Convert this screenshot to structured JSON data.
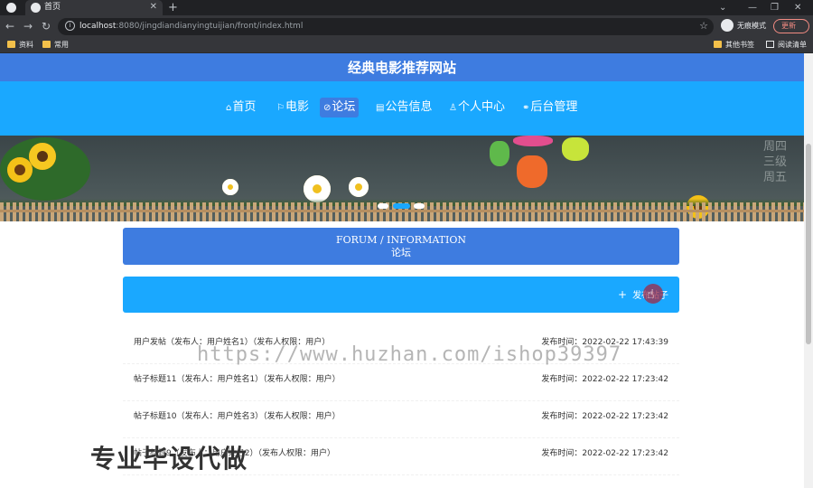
{
  "browser": {
    "tab_title": "首页",
    "tab_close": "✕",
    "new_tab": "+",
    "url_host": "localhost",
    "url_rest": ":8080/jingdiandianyingtuijian/front/index.html",
    "profile_label": "无痕模式",
    "update_label": "更新",
    "bookmarks": [
      "资料",
      "常用"
    ],
    "other_bookmarks": "其他书签",
    "reading_list": "阅读清单",
    "minimize": "—",
    "restore": "❐",
    "close": "✕",
    "back": "←",
    "forward": "→",
    "reload": "↻",
    "star": "☆",
    "tab_menu": "⌄",
    "info": "i"
  },
  "site": {
    "title": "经典电影推荐网站"
  },
  "nav": {
    "items": [
      {
        "icon": "⌂",
        "label": "首页"
      },
      {
        "icon": "⚐",
        "label": "电影"
      },
      {
        "icon": "⊘",
        "label": "论坛",
        "active": true
      },
      {
        "icon": "▤",
        "label": "公告信息"
      },
      {
        "icon": "♙",
        "label": "个人中心"
      },
      {
        "icon": "⚭",
        "label": "后台管理"
      }
    ]
  },
  "banner": {
    "scribble": "周四\n三级\n周五",
    "slides": 3,
    "active_slide": 2
  },
  "forum": {
    "title_en": "FORUM / INFORMATION",
    "title_zh": "论坛",
    "post_button": "发布帖子",
    "post_icon": "+"
  },
  "posts": [
    {
      "title": "用户发帖（发布人：用户姓名1）（发布人权限：用户）",
      "time": "发布时间：2022-02-22 17:43:39"
    },
    {
      "title": "帖子标题11（发布人：用户姓名1）（发布人权限：用户）",
      "time": "发布时间：2022-02-22 17:23:42"
    },
    {
      "title": "帖子标题10（发布人：用户姓名3）（发布人权限：用户）",
      "time": "发布时间：2022-02-22 17:23:42"
    },
    {
      "title": "帖子标题9（发布人：用户姓名2）（发布人权限：用户）",
      "time": "发布时间：2022-02-22 17:23:42"
    }
  ],
  "watermark": "https://www.huzhan.com/ishop39397",
  "overlay": "专业毕设代做",
  "colors": {
    "title_bar": "#3e7ce0",
    "nav_bar": "#1aa8ff",
    "accent": "#3e7ce0"
  }
}
